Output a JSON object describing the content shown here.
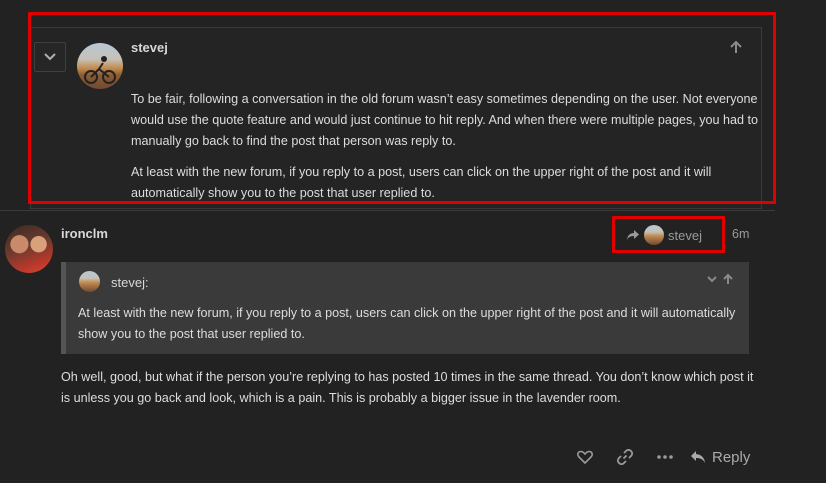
{
  "parent_post": {
    "username": "stevej",
    "collapse_icon": "chevron-down-icon",
    "arrow_icon": "arrow-up-icon",
    "paragraphs": [
      "To be fair, following a conversation in the old forum wasn’t easy sometimes depending on the user. Not everyone would use the quote feature and would just continue to hit reply. And when there were multiple pages, you had to manually go back to find the post that person was reply to.",
      "At least with the new forum, if you reply to a post, users can click on the upper right of the post and it will automatically show you to the post that user replied to."
    ]
  },
  "post": {
    "username": "ironclm",
    "reply_to": {
      "icon": "share-icon",
      "username": "stevej"
    },
    "age": "6m",
    "quote": {
      "username": "stevej:",
      "text": "At least with the new forum, if you reply to a post, users can click on the upper right of the post and it will automatically show you to the post that user replied to."
    },
    "body": "Oh well, good, but what if the person you’re replying to has posted 10 times in the same thread. You don’t know which post it is unless you go back and look, which is a pain. This is probably a bigger issue in the lavender room.",
    "actions": {
      "icons": [
        "heart-icon",
        "link-icon",
        "more-icon"
      ],
      "reply_label": "Reply"
    }
  },
  "colors": {
    "background": "#222222",
    "quote_background": "#3a3a3a",
    "highlight": "#e00000"
  }
}
